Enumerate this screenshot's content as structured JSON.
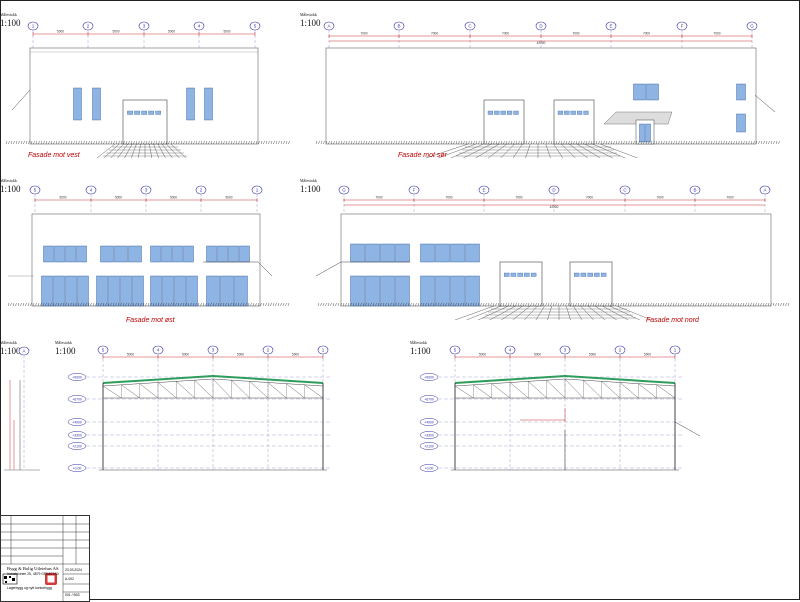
{
  "scale_label": "1:100",
  "scale_caption": "Målestokk",
  "drawings": {
    "vest": {
      "title": "Fasade mot vest",
      "axes": [
        "1",
        "2",
        "3",
        "4",
        "5"
      ],
      "dims": [
        "5000",
        "5000",
        "5000",
        "5000"
      ]
    },
    "sor": {
      "title": "Fasade mot sør",
      "axes": [
        "A",
        "B",
        "C",
        "D",
        "E",
        "F",
        "G"
      ],
      "dims": [
        "7000",
        "7000",
        "7000",
        "7000",
        "7000",
        "7000"
      ],
      "total": "42000"
    },
    "ost": {
      "title": "Fasade mot øst",
      "axes": [
        "5",
        "4",
        "3",
        "2",
        "1"
      ],
      "dims": [
        "5000",
        "5000",
        "5000",
        "5000"
      ]
    },
    "nord": {
      "title": "Fasade mot nord",
      "axes": [
        "G",
        "F",
        "E",
        "D",
        "C",
        "B",
        "A"
      ],
      "dims": [
        "7000",
        "7000",
        "7000",
        "7000",
        "7000",
        "7000"
      ],
      "total": "42000"
    },
    "section_left_axis": "A",
    "section1": {
      "axes": [
        "5",
        "4",
        "3",
        "2",
        "1"
      ],
      "dims": [
        "5000",
        "5000",
        "5000",
        "5000"
      ]
    },
    "section2": {
      "axes": [
        "5",
        "4",
        "3",
        "2",
        "1"
      ],
      "dims": [
        "5000",
        "5000",
        "5000",
        "5000"
      ]
    },
    "levels": [
      "+9000",
      "+6700",
      "+4000",
      "+3300",
      "+2100",
      "+0.00"
    ]
  },
  "title_block": {
    "company": "Bygg & Bolig Utleiehus AS",
    "address": "Industriveien 25, 4879 GRIMSTAD",
    "project": "Lagerbygg og nytt kontorbygg",
    "drawing_no": "A-002",
    "rev": "001 / B03",
    "date": "23.03.2024"
  },
  "colors": {
    "window": "#8eb4e3",
    "dim": "#c00000",
    "axis": "#3333aa",
    "roof": "#2e9c5a"
  }
}
